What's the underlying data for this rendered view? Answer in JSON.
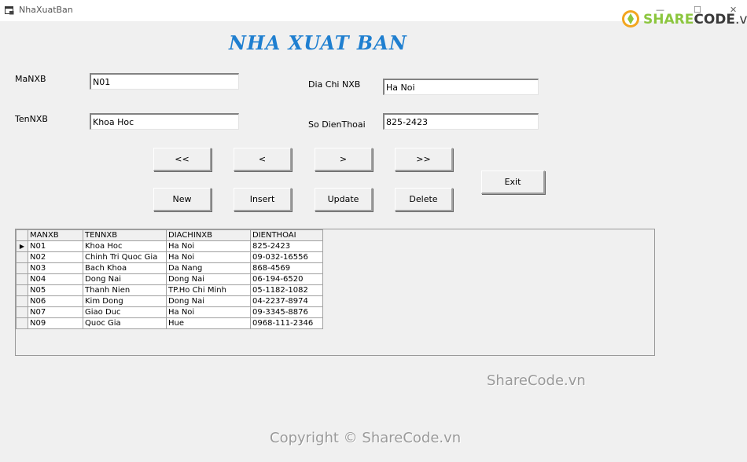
{
  "window": {
    "title": "NhaXuatBan",
    "minimize": "—",
    "maximize": "☐",
    "close": "✕"
  },
  "logo": {
    "share": "SHARE",
    "code": "CODE",
    "vn": ".vn"
  },
  "heading": "NHA XUAT BAN",
  "form": {
    "manxb_label": "MaNXB",
    "manxb_value": "N01",
    "tennxb_label": "TenNXB",
    "tennxb_value": "Khoa Hoc",
    "diachi_label": "Dia Chi NXB",
    "diachi_value": "Ha Noi",
    "sodienthoai_label": "So DienThoai",
    "sodienthoai_value": "825-2423"
  },
  "nav": {
    "first": "<<",
    "prev": "<",
    "next": ">",
    "last": ">>"
  },
  "actions": {
    "new": "New",
    "insert": "Insert",
    "update": "Update",
    "delete": "Delete",
    "exit": "Exit"
  },
  "grid": {
    "columns": [
      "MANXB",
      "TENNXB",
      "DIACHINXB",
      "DIENTHOAI"
    ],
    "current_row_marker": "▶",
    "rows": [
      [
        "N01",
        "Khoa Hoc",
        "Ha Noi",
        "825-2423"
      ],
      [
        "N02",
        "Chinh Tri Quoc Gia",
        "Ha Noi",
        "09-032-16556"
      ],
      [
        "N03",
        "Bach Khoa",
        "Da Nang",
        "868-4569"
      ],
      [
        "N04",
        "Dong Nai",
        "Dong Nai",
        "06-194-6520"
      ],
      [
        "N05",
        "Thanh Nien",
        "TP.Ho Chi Minh",
        "05-1182-1082"
      ],
      [
        "N06",
        "Kim Dong",
        "Dong Nai",
        "04-2237-8974"
      ],
      [
        "N07",
        "Giao Duc",
        "Ha Noi",
        "09-3345-8876"
      ],
      [
        "N09",
        "Quoc Gia",
        "Hue",
        "0968-111-2346"
      ]
    ]
  },
  "watermark": {
    "center": "ShareCode.vn",
    "copyright": "Copyright © ShareCode.vn"
  }
}
